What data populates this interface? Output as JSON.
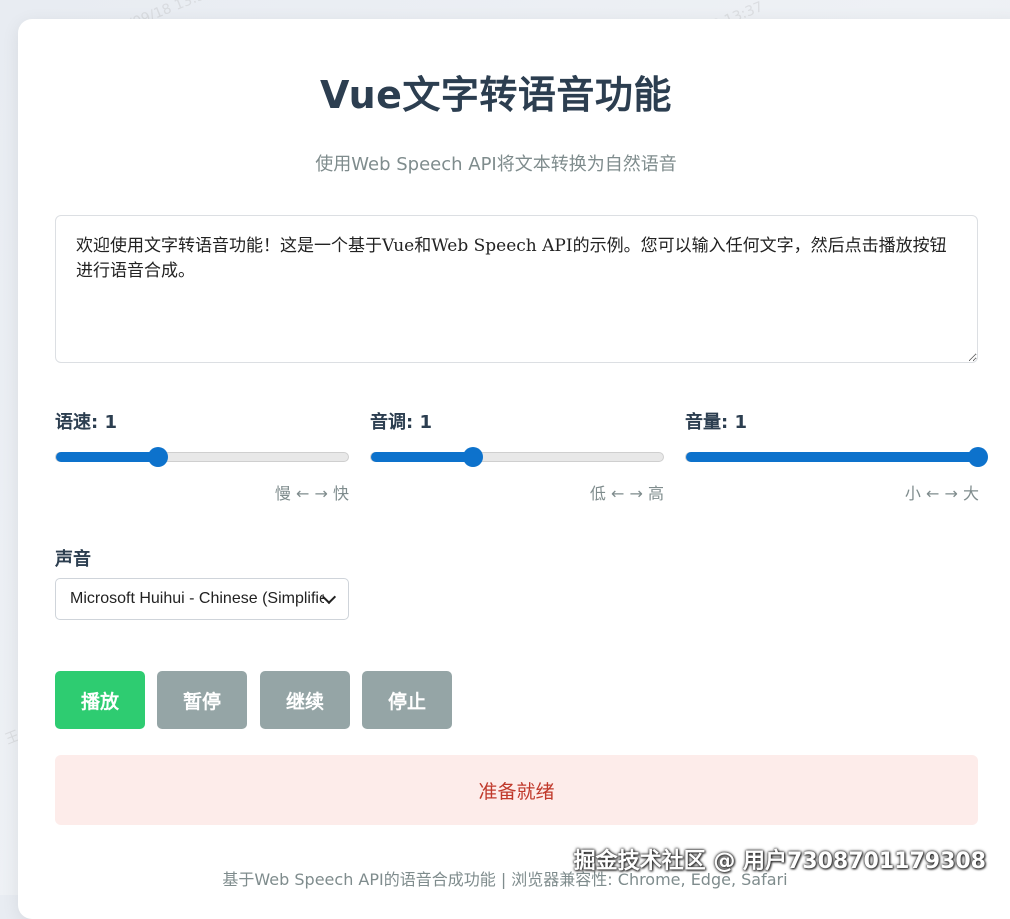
{
  "page": {
    "title": "Vue文字转语音功能",
    "subtitle": "使用Web Speech API将文本转换为自然语音"
  },
  "text_input": {
    "value": "欢迎使用文字转语音功能！这是一个基于Vue和Web Speech API的示例。您可以输入任何文字，然后点击播放按钮进行语音合成。"
  },
  "controls": {
    "rate": {
      "label": "语速: 1",
      "hint": "慢 ← → 快",
      "level": 0.35
    },
    "pitch": {
      "label": "音调: 1",
      "hint": "低 ← → 高",
      "level": 0.35
    },
    "volume": {
      "label": "音量: 1",
      "hint": "小 ← → 大",
      "level": 1.0
    }
  },
  "voice": {
    "label": "声音",
    "selected": "Microsoft Huihui - Chinese (Simplified, PRC)"
  },
  "buttons": {
    "play": "播放",
    "pause": "暂停",
    "resume": "继续",
    "stop": "停止"
  },
  "status": {
    "text": "准备就绪"
  },
  "footer": {
    "text": "基于Web Speech API的语音合成功能 | 浏览器兼容性: Chrome, Edge, Safari"
  },
  "overlay": {
    "community": "掘金技术社区 @ 用户7308701179308"
  },
  "watermark": {
    "text": "王一 2025/09/18 13:37"
  },
  "colors": {
    "accent": "#0d72cc",
    "play_button": "#2ecc71",
    "secondary_button": "#95a5a6",
    "status_bg": "#fdecea",
    "status_text": "#c0392b",
    "title": "#2c3e50",
    "muted": "#7f8c8d"
  }
}
